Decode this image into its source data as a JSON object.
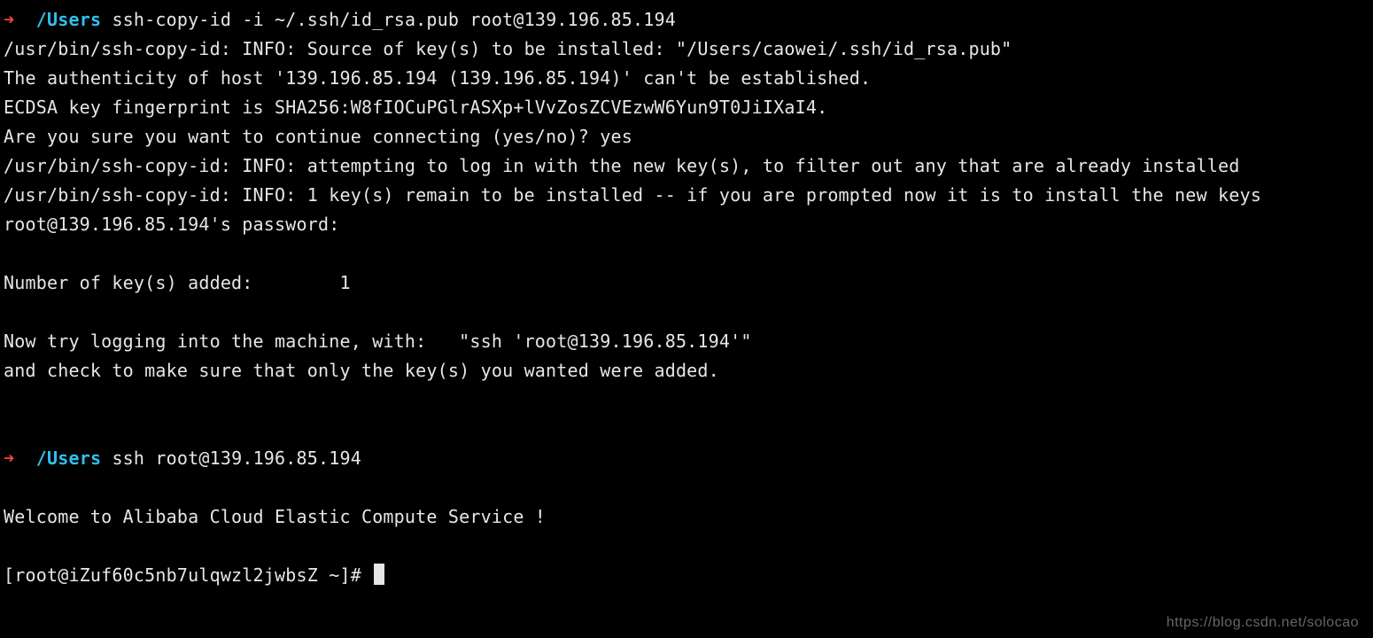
{
  "prompt1": {
    "arrow": "➜",
    "cwd": "/Users",
    "command": "ssh-copy-id -i ~/.ssh/id_rsa.pub root@139.196.85.194"
  },
  "output1": {
    "l1": "/usr/bin/ssh-copy-id: INFO: Source of key(s) to be installed: \"/Users/caowei/.ssh/id_rsa.pub\"",
    "l2": "The authenticity of host '139.196.85.194 (139.196.85.194)' can't be established.",
    "l3": "ECDSA key fingerprint is SHA256:W8fIOCuPGlrASXp+lVvZosZCVEzwW6Yun9T0JiIXaI4.",
    "l4": "Are you sure you want to continue connecting (yes/no)? yes",
    "l5": "/usr/bin/ssh-copy-id: INFO: attempting to log in with the new key(s), to filter out any that are already installed",
    "l6": "/usr/bin/ssh-copy-id: INFO: 1 key(s) remain to be installed -- if you are prompted now it is to install the new keys",
    "l7": "root@139.196.85.194's password:",
    "l8": "Number of key(s) added:        1",
    "l9": "Now try logging into the machine, with:   \"ssh 'root@139.196.85.194'\"",
    "l10": "and check to make sure that only the key(s) you wanted were added."
  },
  "prompt2": {
    "arrow": "➜",
    "cwd": "/Users",
    "command": "ssh root@139.196.85.194"
  },
  "output2": {
    "l1": "Welcome to Alibaba Cloud Elastic Compute Service !"
  },
  "remote_prompt": "[root@iZuf60c5nb7ulqwzl2jwbsZ ~]# ",
  "watermark": "https://blog.csdn.net/solocao"
}
